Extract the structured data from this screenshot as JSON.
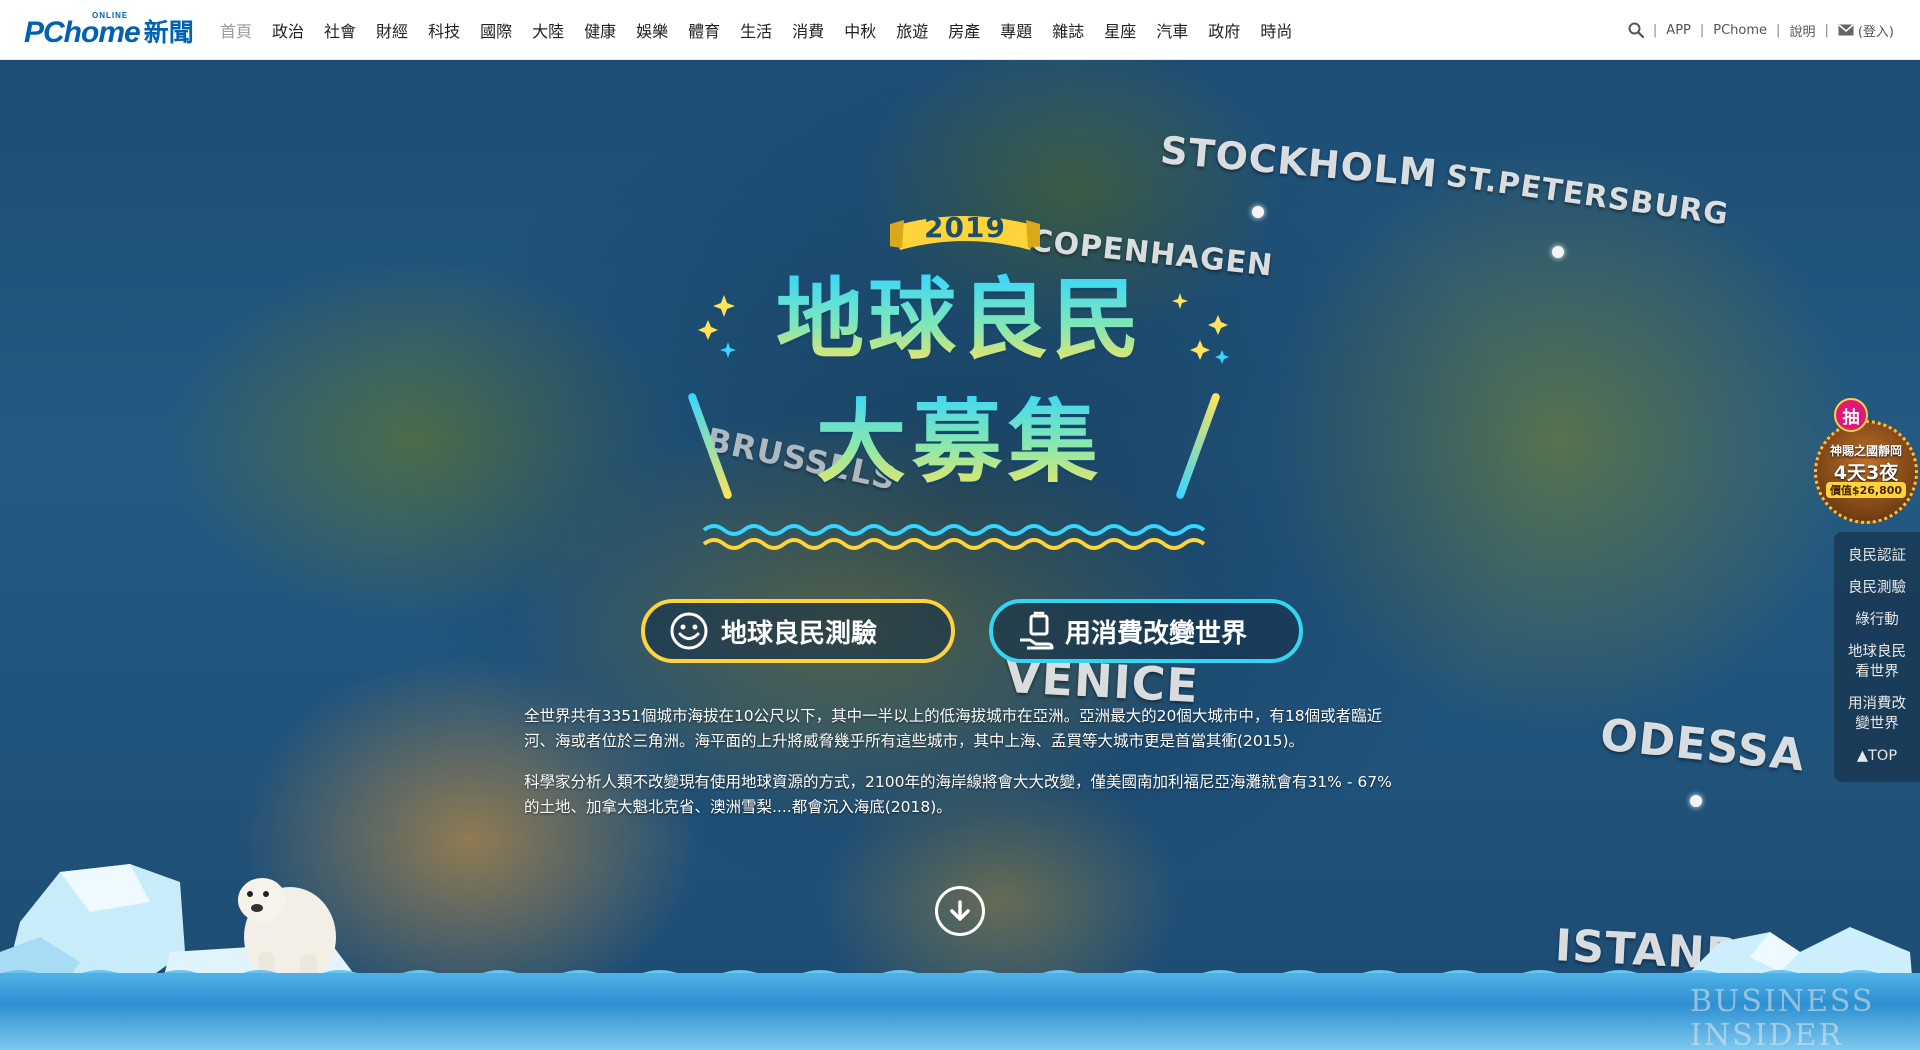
{
  "header": {
    "logo": {
      "brand": "PChome",
      "badge": "ONLINE",
      "section": "新聞"
    },
    "nav": [
      "首頁",
      "政治",
      "社會",
      "財經",
      "科技",
      "國際",
      "大陸",
      "健康",
      "娛樂",
      "體育",
      "生活",
      "消費",
      "中秋",
      "旅遊",
      "房產",
      "專題",
      "雜誌",
      "星座",
      "汽車",
      "政府",
      "時尚"
    ],
    "active_nav": "首頁",
    "right_links": {
      "search_icon": "search-icon",
      "app": "APP",
      "pchome": "PChome",
      "help": "說明",
      "mail_icon": "mail-icon",
      "login": "(登入)"
    }
  },
  "hero": {
    "map_cities": [
      "STOCKHOLM",
      "ST.PETERSBURG",
      "COPENHAGEN",
      "BRUSSELS",
      "VENICE",
      "ODESSA",
      "ISTANB"
    ],
    "year": "2019",
    "title_line1": "地球良民",
    "title_line2": "大募集",
    "buttons": [
      {
        "label": "地球良民測驗",
        "icon": "smiley-icon"
      },
      {
        "label": "用消費改變世界",
        "icon": "shopping-bag-hand-icon"
      }
    ],
    "paragraphs": [
      "全世界共有3351個城市海拔在10公尺以下，其中一半以上的低海拔城市在亞洲。亞洲最大的20個大城市中，有18個或者臨近河、海或者位於三角洲。海平面的上升將威脅幾乎所有這些城市，其中上海、孟買等大城市更是首當其衝(2015)。",
      "科學家分析人類不改變現有使用地球資源的方式，2100年的海岸線將會大大改變，僅美國南加利福尼亞海灘就會有31% - 67%的土地、加拿大魁北克省、澳洲雪梨....都會沉入海底(2018)。"
    ],
    "scroll_icon": "arrow-down-circle-icon",
    "watermark": [
      "BUSINESS",
      "INSIDER"
    ]
  },
  "promo": {
    "bubble": "抽",
    "line1": "神賜之國靜岡",
    "line2": "4天3夜",
    "price": "價值$26,800"
  },
  "side_menu": [
    "良民認証",
    "良民測驗",
    "綠行動",
    "地球良民看世界",
    "用消費改變世界",
    "▲TOP"
  ],
  "colors": {
    "brand_blue": "#0062b1",
    "accent_yellow": "#ffd43a",
    "accent_cyan": "#33d6f2",
    "promo_pink": "#e0187a"
  }
}
